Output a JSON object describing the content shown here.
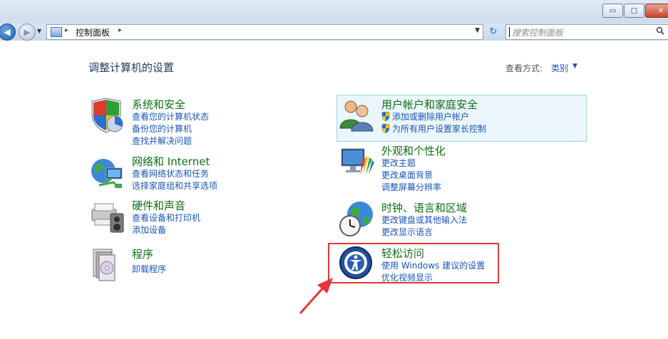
{
  "window": {
    "minimize_glyph": "▭",
    "maximize_glyph": "□",
    "close_glyph": "✕"
  },
  "navigation": {
    "back_glyph": "◀",
    "forward_glyph": "▶",
    "recent_glyph": "▼",
    "address": {
      "separator": "▸",
      "location": "控制面板",
      "dropdown_glyph": "▼"
    },
    "refresh_glyph": "↻",
    "search": {
      "placeholder": "搜索控制面板",
      "icon": "search-icon"
    }
  },
  "header": {
    "title": "调整计算机的设置",
    "view_by_label": "查看方式:",
    "view_by_value": "类别",
    "view_by_arrow": "▼"
  },
  "categories": [
    {
      "title": "系统和安全",
      "icon": "system-security-icon",
      "links": [
        "查看您的计算机状态",
        "备份您的计算机",
        "查找并解决问题"
      ]
    },
    {
      "title": "网络和 Internet",
      "icon": "network-icon",
      "links": [
        "查看网络状态和任务",
        "选择家庭组和共享选项"
      ]
    },
    {
      "title": "硬件和声音",
      "icon": "hardware-sound-icon",
      "links": [
        "查看设备和打印机",
        "添加设备"
      ]
    },
    {
      "title": "程序",
      "icon": "programs-icon",
      "links": [
        "卸载程序"
      ]
    },
    {
      "title": "用户帐户和家庭安全",
      "icon": "user-accounts-icon",
      "links": [
        "添加或删除用户帐户",
        "为所有用户设置家长控制"
      ]
    },
    {
      "title": "外观和个性化",
      "icon": "appearance-icon",
      "links": [
        "更改主题",
        "更改桌面背景",
        "调整屏幕分辨率"
      ]
    },
    {
      "title": "时钟、语言和区域",
      "icon": "clock-language-icon",
      "links": [
        "更改键盘或其他输入法",
        "更改显示语言"
      ]
    },
    {
      "title": "轻松访问",
      "icon": "ease-of-access-icon",
      "links": [
        "使用 Windows 建议的设置",
        "优化视频显示"
      ]
    }
  ],
  "colors": {
    "category_title": "#0e6e13",
    "link": "#1a55b8",
    "annotation": "#e7353a"
  }
}
